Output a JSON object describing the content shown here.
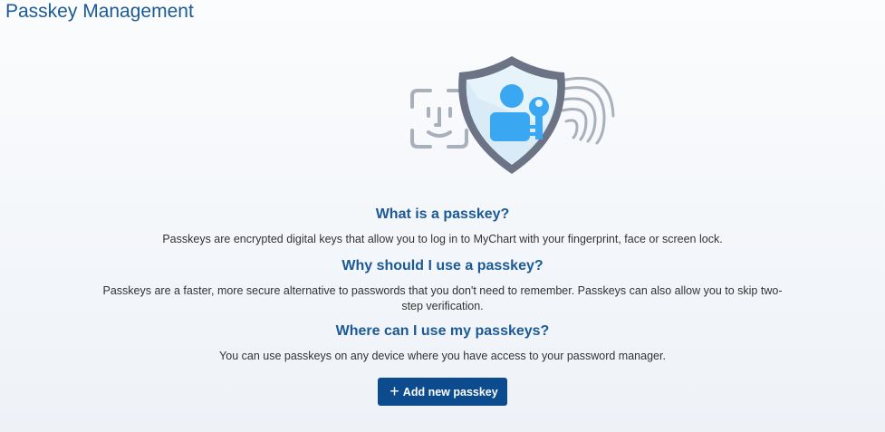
{
  "page": {
    "title": "Passkey Management"
  },
  "illustration": {
    "icons": [
      "face-id-icon",
      "shield-icon",
      "user-icon",
      "key-icon",
      "fingerprint-icon"
    ],
    "colors": {
      "shield_stroke": "#6b7384",
      "shield_fill": "#d8ebf6",
      "accent": "#3aa7f2",
      "outline": "#a8b0bb"
    }
  },
  "sections": [
    {
      "heading": "What is a passkey?",
      "text": "Passkeys are encrypted digital keys that allow you to log in to MyChart with your fingerprint, face or screen lock."
    },
    {
      "heading": "Why should I use a passkey?",
      "text": "Passkeys are a faster, more secure alternative to passwords that you don't need to remember. Passkeys can also allow you to skip two-step verification."
    },
    {
      "heading": "Where can I use my passkeys?",
      "text": "You can use passkeys on any device where you have access to your password manager."
    }
  ],
  "actions": {
    "add_label": "Add new passkey",
    "add_icon": "+"
  },
  "colors": {
    "heading": "#1c5a96",
    "button": "#0c4b8e"
  }
}
